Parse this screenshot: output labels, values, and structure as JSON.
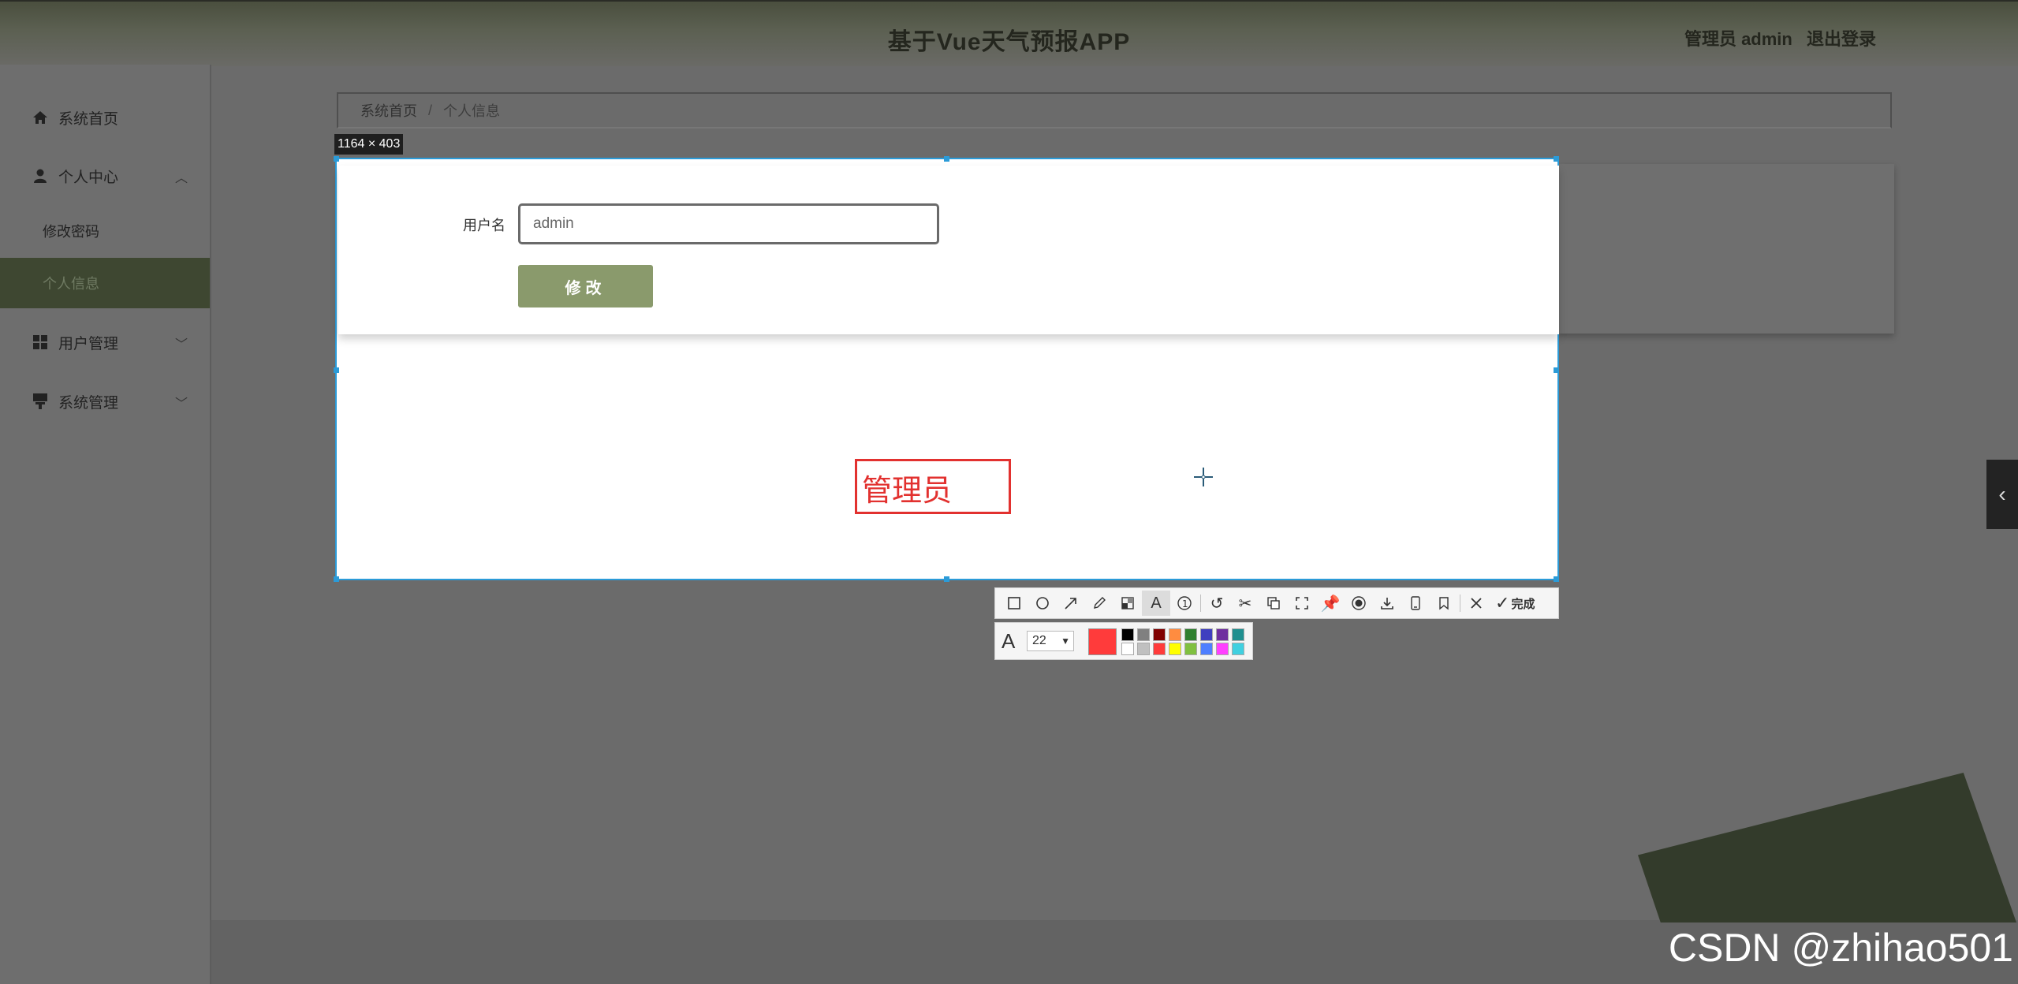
{
  "header": {
    "title": "基于Vue天气预报APP",
    "user_label": "管理员 admin",
    "logout_label": "退出登录"
  },
  "sidebar": {
    "items": [
      {
        "label": "系统首页",
        "icon": "home-icon"
      },
      {
        "label": "个人中心",
        "icon": "user-icon",
        "expanded": true,
        "children": [
          {
            "label": "修改密码"
          },
          {
            "label": "个人信息",
            "active": true
          }
        ]
      },
      {
        "label": "用户管理",
        "icon": "grid-icon"
      },
      {
        "label": "系统管理",
        "icon": "system-icon"
      }
    ]
  },
  "breadcrumb": {
    "home": "系统首页",
    "separator": "/",
    "current": "个人信息"
  },
  "form": {
    "username_label": "用户名",
    "username_value": "admin",
    "submit_label": "修改"
  },
  "screenshot": {
    "dimensions_label": "1164 × 403",
    "text_annotation": "管理员",
    "font_size": "22",
    "done_label": "完成",
    "current_color": "#ff3b3b",
    "palette": [
      "#000000",
      "#808080",
      "#800000",
      "#ff8c40",
      "#2f7f2f",
      "#3f3fbf",
      "#6f2f9f",
      "#1f8f8f",
      "#ffffff",
      "#c0c0c0",
      "#ff3b3b",
      "#ffff00",
      "#80c040",
      "#4f7fff",
      "#ff40ff",
      "#40d0e0"
    ],
    "tools": [
      "rectangle-icon",
      "ellipse-icon",
      "arrow-icon",
      "pencil-icon",
      "mosaic-icon",
      "text-icon",
      "number-icon",
      "undo-icon",
      "scissors-icon",
      "copy-icon",
      "fullscreen-icon",
      "pin-icon",
      "record-icon",
      "download-icon",
      "phone-icon",
      "bookmark-icon",
      "close-icon",
      "check-icon"
    ]
  },
  "watermark": "CSDN @zhihao501"
}
